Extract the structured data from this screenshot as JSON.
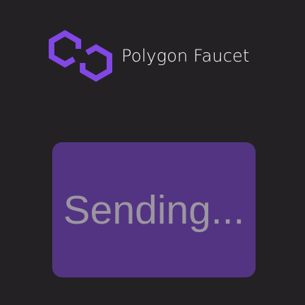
{
  "header": {
    "title": "Polygon Faucet",
    "logo_icon": "polygon-logo-icon"
  },
  "button": {
    "label": "Sending..."
  },
  "colors": {
    "background": "#232124",
    "brand_purple": "#8247e5",
    "button_bg": "#533483",
    "button_text": "#9c96a0",
    "title_text": "#ffffff"
  }
}
